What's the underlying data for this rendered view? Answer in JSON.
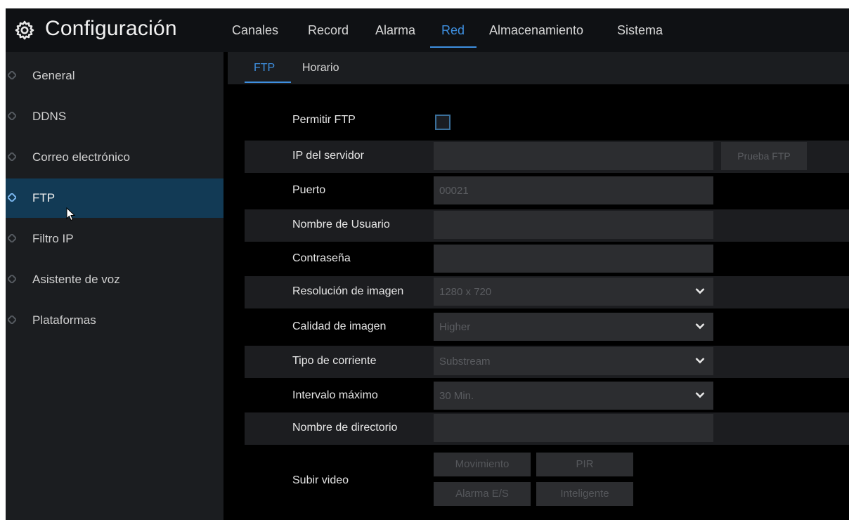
{
  "header": {
    "title": "Configuración",
    "icon": "gear-icon",
    "tabs": [
      {
        "label": "Canales",
        "active": false
      },
      {
        "label": "Record",
        "active": false
      },
      {
        "label": "Alarma",
        "active": false
      },
      {
        "label": "Red",
        "active": true
      },
      {
        "label": "Almacenamiento",
        "active": false
      },
      {
        "label": "Sistema",
        "active": false
      }
    ]
  },
  "sidebar": {
    "items": [
      {
        "label": "General",
        "active": false
      },
      {
        "label": "DDNS",
        "active": false
      },
      {
        "label": "Correo electrónico",
        "active": false
      },
      {
        "label": "FTP",
        "active": true
      },
      {
        "label": "Filtro IP",
        "active": false
      },
      {
        "label": "Asistente de voz",
        "active": false
      },
      {
        "label": "Plataformas",
        "active": false
      }
    ]
  },
  "subtabs": [
    {
      "label": "FTP",
      "active": true
    },
    {
      "label": "Horario",
      "active": false
    }
  ],
  "form": {
    "enable_ftp": {
      "label": "Permitir FTP",
      "checked": false
    },
    "server_ip": {
      "label": "IP del servidor",
      "value": ""
    },
    "test_button": "Prueba FTP",
    "port": {
      "label": "Puerto",
      "value": "00021"
    },
    "username": {
      "label": "Nombre de Usuario",
      "value": ""
    },
    "password": {
      "label": "Contraseña",
      "value": ""
    },
    "image_resolution": {
      "label": "Resolución de imagen",
      "value": "1280 x 720"
    },
    "image_quality": {
      "label": "Calidad de imagen",
      "value": "Higher"
    },
    "stream_type": {
      "label": "Tipo de corriente",
      "value": "Substream"
    },
    "max_interval": {
      "label": "Intervalo máximo",
      "value": "30 Min."
    },
    "directory_name": {
      "label": "Nombre de directorio",
      "value": ""
    },
    "upload_video": {
      "label": "Subir video",
      "buttons": [
        "Movimiento",
        "PIR",
        "Alarma E/S",
        "Inteligente"
      ]
    }
  },
  "colors": {
    "accent": "#3e8fe0",
    "active_sidebar_bg": "#123a55"
  }
}
